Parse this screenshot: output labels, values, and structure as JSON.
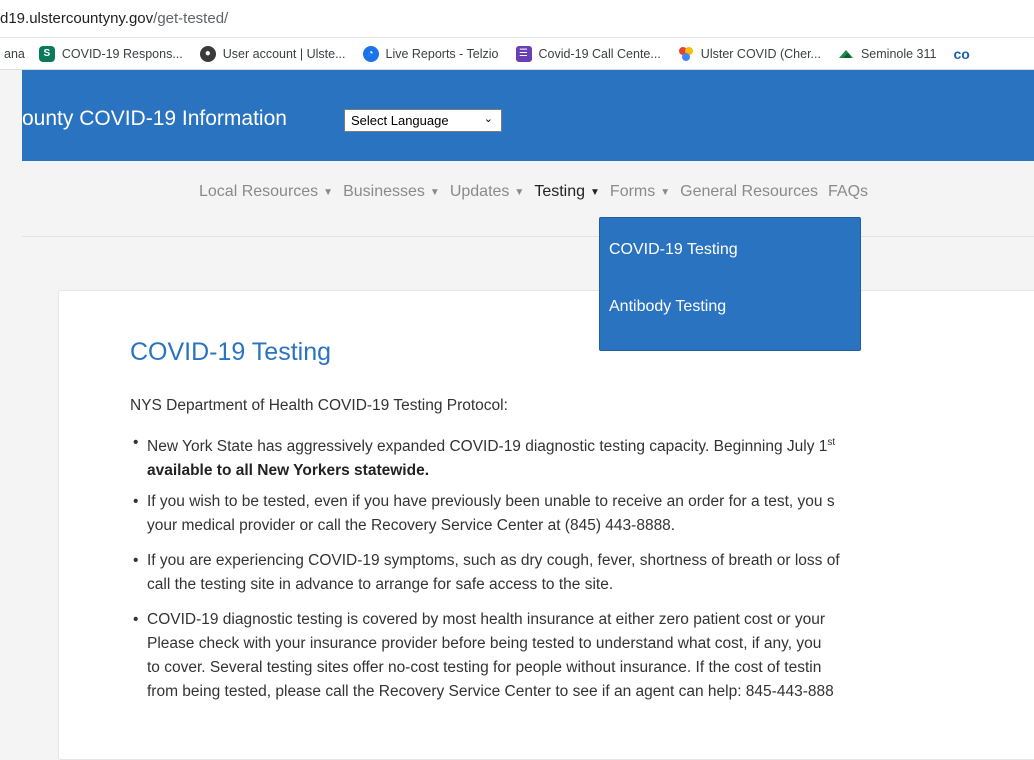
{
  "browser": {
    "url_host": "d19.ulstercountyny.gov",
    "url_path": "/get-tested/",
    "bookmarks": [
      {
        "label": "ana",
        "icon": ""
      },
      {
        "label": "COVID-19 Respons...",
        "icon": "sharepoint-icon"
      },
      {
        "label": "User account | Ulste...",
        "icon": "user-account-icon"
      },
      {
        "label": "Live Reports - Telzio",
        "icon": "telzio-icon"
      },
      {
        "label": "Covid-19 Call Cente...",
        "icon": "forms-icon"
      },
      {
        "label": "Ulster COVID (Cher...",
        "icon": "pinwheel-icon"
      },
      {
        "label": "Seminole 311",
        "icon": "seminole-icon"
      }
    ]
  },
  "header": {
    "title": "ounty COVID-19 Information",
    "language_select": "Select Language",
    "bg_color": "#2a73c1"
  },
  "nav": {
    "items": [
      {
        "label": "Local Resources",
        "caret": true
      },
      {
        "label": "Businesses",
        "caret": true
      },
      {
        "label": "Updates",
        "caret": true
      },
      {
        "label": "Testing",
        "caret": true
      },
      {
        "label": "Forms",
        "caret": true
      },
      {
        "label": "General Resources",
        "caret": false
      },
      {
        "label": "FAQs",
        "caret": false
      }
    ],
    "dropdown": [
      "COVID-19 Testing",
      "Antibody Testing"
    ]
  },
  "content": {
    "title": "COVID-19 Testing",
    "protocol_heading": "NYS Department of Health COVID-19 Testing Protocol:",
    "bullets": [
      [
        "New York State has aggressively expanded COVID-19 diagnostic testing capacity. Beginning July 1",
        "available to all New Yorkers statewide."
      ],
      [
        "If you wish to be tested, even if you have previously been unable to receive an order for a test, you s",
        "your medical provider or call the Recovery Service Center at (845) 443-8888."
      ],
      [
        "If you are experiencing COVID-19 symptoms, such as dry cough, fever, shortness of breath or loss of",
        "call the testing site in advance to arrange for safe access to the site."
      ],
      [
        "COVID-19 diagnostic testing is covered by most health insurance at either zero patient cost or your",
        "Please check with your insurance provider before being tested to understand what cost, if any, you",
        "to cover. Several testing sites offer no-cost testing for people without insurance. If the cost of testin",
        "from being tested, please call the Recovery Service Center to see if an agent can help: 845-443-888"
      ]
    ],
    "superscript": "st"
  }
}
